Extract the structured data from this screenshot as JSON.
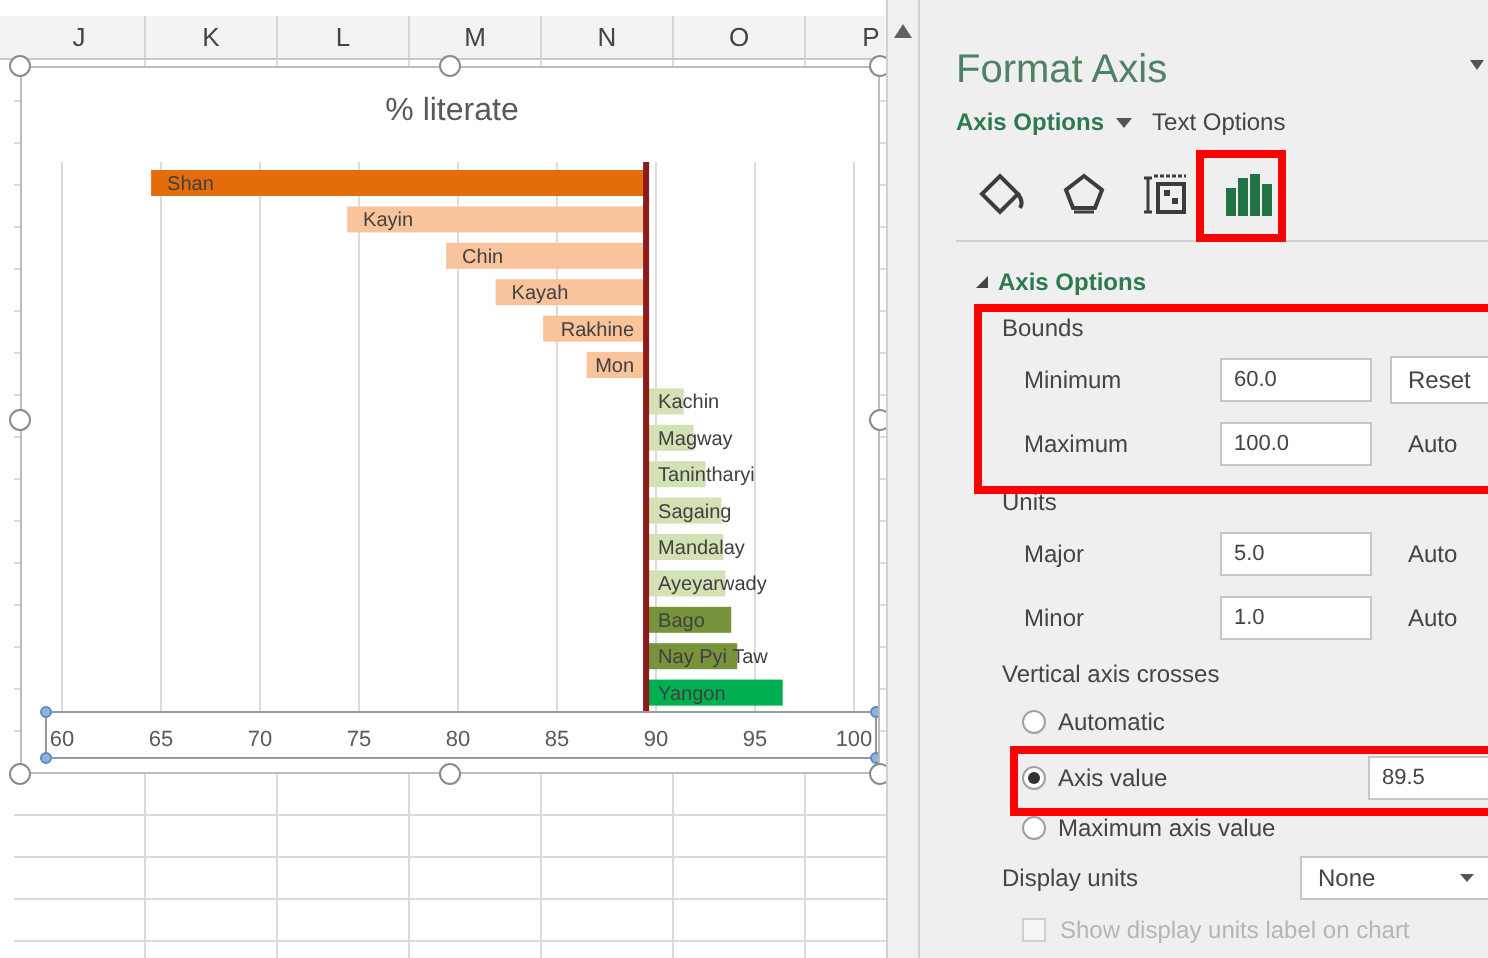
{
  "spreadsheet": {
    "columns": [
      "J",
      "K",
      "L",
      "M",
      "N",
      "O",
      "P"
    ]
  },
  "chart": {
    "bars": [
      {
        "color": "#e46c0a"
      },
      {
        "color": "#f9c49c"
      },
      {
        "color": "#f9c49c"
      },
      {
        "color": "#f9c49c"
      },
      {
        "color": "#f9c49c"
      },
      {
        "color": "#f9c49c"
      },
      {
        "color": "#d3e2b5"
      },
      {
        "color": "#d3e2b5"
      },
      {
        "color": "#d3e2b5"
      },
      {
        "color": "#d3e2b5"
      },
      {
        "color": "#d3e2b5"
      },
      {
        "color": "#d3e2b5"
      },
      {
        "color": "#77933c"
      },
      {
        "color": "#77933c"
      },
      {
        "color": "#00b050"
      }
    ],
    "chart_data": {
      "type": "bar",
      "orientation": "horizontal",
      "title": "% literate",
      "categories": [
        "Shan",
        "Kayin",
        "Chin",
        "Kayah",
        "Rakhine",
        "Mon",
        "Kachin",
        "Magway",
        "Tanintharyi",
        "Sagaing",
        "Mandalay",
        "Ayeyarwady",
        "Bago",
        "Nay Pyi Taw",
        "Yangon"
      ],
      "series": [
        {
          "base": [
            89.5,
            89.5,
            89.5,
            89.5,
            89.5,
            89.5,
            89.5,
            89.5,
            89.5,
            89.5,
            89.5,
            89.5,
            89.5,
            89.5,
            89.5
          ],
          "values": [
            -25.0,
            -15.1,
            -10.1,
            -7.6,
            -5.2,
            -3.0,
            1.9,
            2.4,
            3.0,
            3.8,
            3.9,
            4.0,
            4.3,
            4.6,
            6.9
          ]
        }
      ],
      "xlim": [
        60,
        100
      ],
      "xticks": [
        60,
        65,
        70,
        75,
        80,
        85,
        90,
        95,
        100
      ],
      "grid": true
    }
  },
  "panel": {
    "title": "Format Axis",
    "tabs": [
      {
        "label": "Axis Options",
        "selected": true
      },
      {
        "label": "Text Options",
        "selected": false
      }
    ],
    "icon_tabs": [
      {
        "kind": "fill",
        "selected": false
      },
      {
        "kind": "effects",
        "selected": false
      },
      {
        "kind": "size",
        "selected": false
      },
      {
        "kind": "chart",
        "selected": true
      }
    ],
    "section": {
      "title": "Axis Options",
      "expanded": true
    },
    "bounds": {
      "label": "Bounds",
      "rows": [
        {
          "label": "Minimum",
          "value": "60.0",
          "action": "Reset",
          "kind": "button"
        },
        {
          "label": "Maximum",
          "value": "100.0",
          "action": "Auto",
          "kind": "text"
        }
      ]
    },
    "units": {
      "label": "Units",
      "rows": [
        {
          "label": "Major",
          "value": "5.0",
          "action": "Auto",
          "kind": "text"
        },
        {
          "label": "Minor",
          "value": "1.0",
          "action": "Auto",
          "kind": "text"
        }
      ]
    },
    "crosses": {
      "label": "Vertical axis crosses",
      "options": [
        {
          "label": "Automatic",
          "selected": false
        },
        {
          "label": "Axis value",
          "selected": true,
          "value": "89.5"
        },
        {
          "label": "Maximum axis value",
          "selected": false
        }
      ]
    },
    "display_units": {
      "label": "Display units",
      "value": "None"
    },
    "show_units_label": {
      "label": "Show display units label on chart",
      "checked": false,
      "disabled": true
    }
  }
}
